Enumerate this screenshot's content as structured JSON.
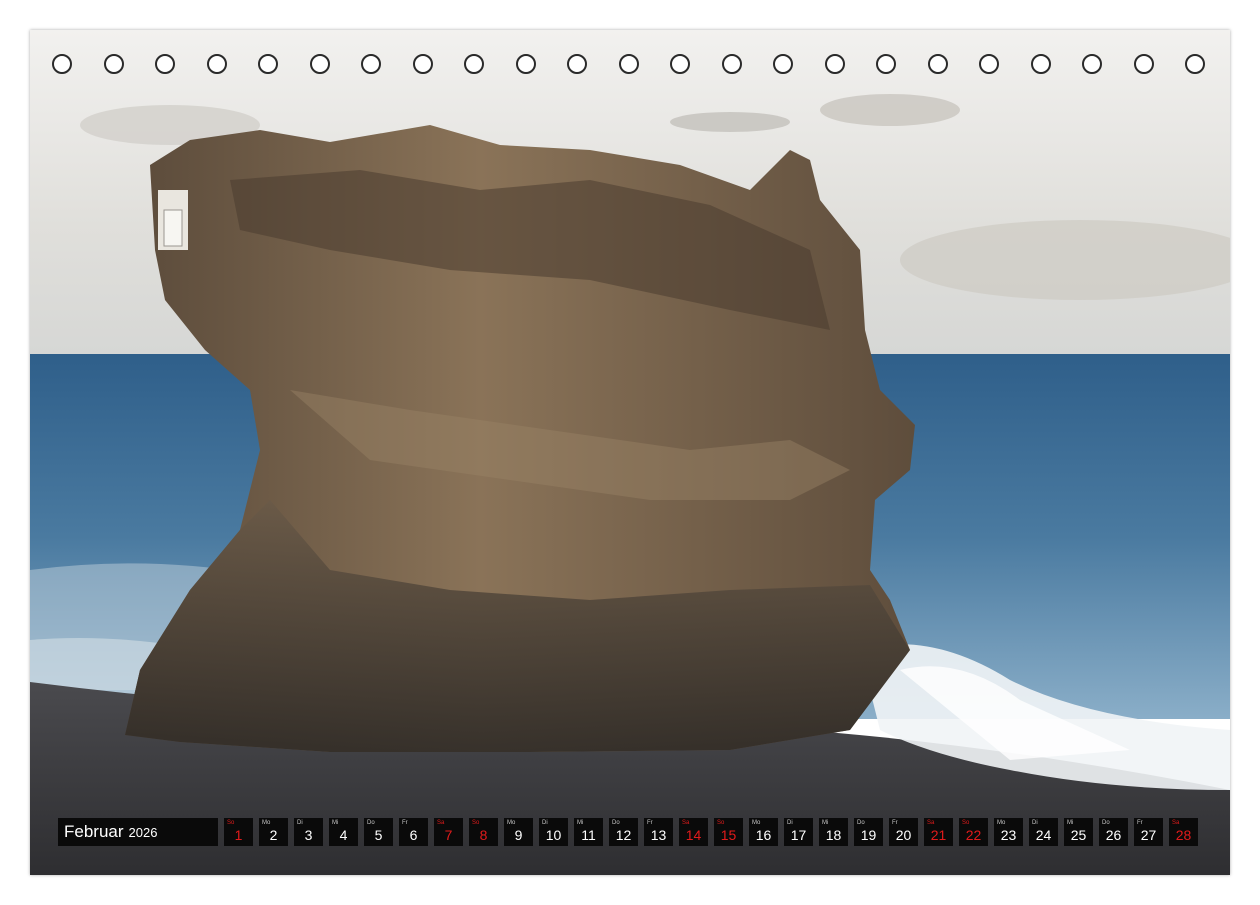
{
  "calendar": {
    "month": "Februar",
    "year": "2026",
    "days": [
      {
        "wd": "So",
        "n": "1",
        "red": true
      },
      {
        "wd": "Mo",
        "n": "2",
        "red": false
      },
      {
        "wd": "Di",
        "n": "3",
        "red": false
      },
      {
        "wd": "Mi",
        "n": "4",
        "red": false
      },
      {
        "wd": "Do",
        "n": "5",
        "red": false
      },
      {
        "wd": "Fr",
        "n": "6",
        "red": false
      },
      {
        "wd": "Sa",
        "n": "7",
        "red": true
      },
      {
        "wd": "So",
        "n": "8",
        "red": true
      },
      {
        "wd": "Mo",
        "n": "9",
        "red": false
      },
      {
        "wd": "Di",
        "n": "10",
        "red": false
      },
      {
        "wd": "Mi",
        "n": "11",
        "red": false
      },
      {
        "wd": "Do",
        "n": "12",
        "red": false
      },
      {
        "wd": "Fr",
        "n": "13",
        "red": false
      },
      {
        "wd": "Sa",
        "n": "14",
        "red": true
      },
      {
        "wd": "So",
        "n": "15",
        "red": true
      },
      {
        "wd": "Mo",
        "n": "16",
        "red": false
      },
      {
        "wd": "Di",
        "n": "17",
        "red": false
      },
      {
        "wd": "Mi",
        "n": "18",
        "red": false
      },
      {
        "wd": "Do",
        "n": "19",
        "red": false
      },
      {
        "wd": "Fr",
        "n": "20",
        "red": false
      },
      {
        "wd": "Sa",
        "n": "21",
        "red": true
      },
      {
        "wd": "So",
        "n": "22",
        "red": true
      },
      {
        "wd": "Mo",
        "n": "23",
        "red": false
      },
      {
        "wd": "Di",
        "n": "24",
        "red": false
      },
      {
        "wd": "Mi",
        "n": "25",
        "red": false
      },
      {
        "wd": "Do",
        "n": "26",
        "red": false
      },
      {
        "wd": "Fr",
        "n": "27",
        "red": false
      },
      {
        "wd": "Sa",
        "n": "28",
        "red": true
      }
    ]
  },
  "colors": {
    "strip_bg": "#0a0a0a",
    "weekend_red": "#e11b1b",
    "sea": "#3f6f96",
    "sand": "#3a3a3d",
    "rock": "#6b5a45"
  },
  "ring_binding": {
    "hole_count": 23
  }
}
